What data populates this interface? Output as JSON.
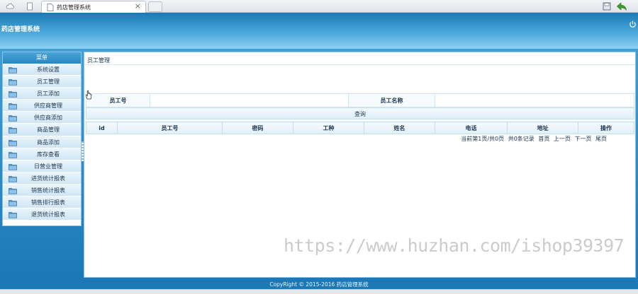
{
  "browser": {
    "tab_title": "药店管理系统",
    "tab_close": "×"
  },
  "header": {
    "app_title": "药店管理系统"
  },
  "sidebar": {
    "title": "菜单",
    "items": [
      {
        "label": "系统设置"
      },
      {
        "label": "员工管理"
      },
      {
        "label": "员工添加"
      },
      {
        "label": "供应商管理"
      },
      {
        "label": "供应商添加"
      },
      {
        "label": "商品管理"
      },
      {
        "label": "商品添加"
      },
      {
        "label": "库存查看"
      },
      {
        "label": "日营业管理"
      },
      {
        "label": "进货统计报表"
      },
      {
        "label": "销售统计报表"
      },
      {
        "label": "销售排行报表"
      },
      {
        "label": "退货统计报表"
      }
    ]
  },
  "main": {
    "breadcrumb": "员工管理",
    "search": {
      "employee_no_label": "员工号",
      "employee_name_label": "员工名称",
      "query_button": "查询"
    },
    "table": {
      "columns": [
        "id",
        "员工号",
        "密码",
        "工种",
        "姓名",
        "电话",
        "地址",
        "操作"
      ]
    },
    "pager": {
      "info": "当前第1页/共0页",
      "count": "共0条记录",
      "first": "首页",
      "prev": "上一页",
      "next": "下一页",
      "last": "尾页"
    }
  },
  "watermark": "https://www.huzhan.com/ishop39397",
  "footer": {
    "copyright": "CopyRight © 2015-2016 药店管理系统"
  },
  "colors": {
    "header_blue": "#2a86c0",
    "panel_border": "#8ec3e3",
    "footer_blue": "#1d79b6"
  }
}
